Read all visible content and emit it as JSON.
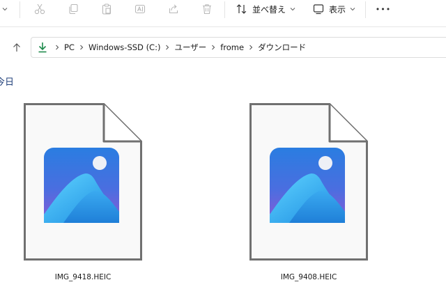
{
  "toolbar": {
    "sort_label": "並べ替え",
    "view_label": "表示",
    "more_label": "•••"
  },
  "address": {
    "crumbs": [
      "PC",
      "Windows-SSD (C:)",
      "ユーザー",
      "frome",
      "ダウンロード"
    ]
  },
  "group": {
    "header": "今日"
  },
  "files": [
    {
      "name": "IMG_9418.HEIC"
    },
    {
      "name": "IMG_9408.HEIC"
    }
  ],
  "colors": {
    "accent_green": "#1e8a4c",
    "group_header": "#1f3f7a",
    "icon_blue": "#2a7de1",
    "icon_purple": "#8a5bd6"
  }
}
